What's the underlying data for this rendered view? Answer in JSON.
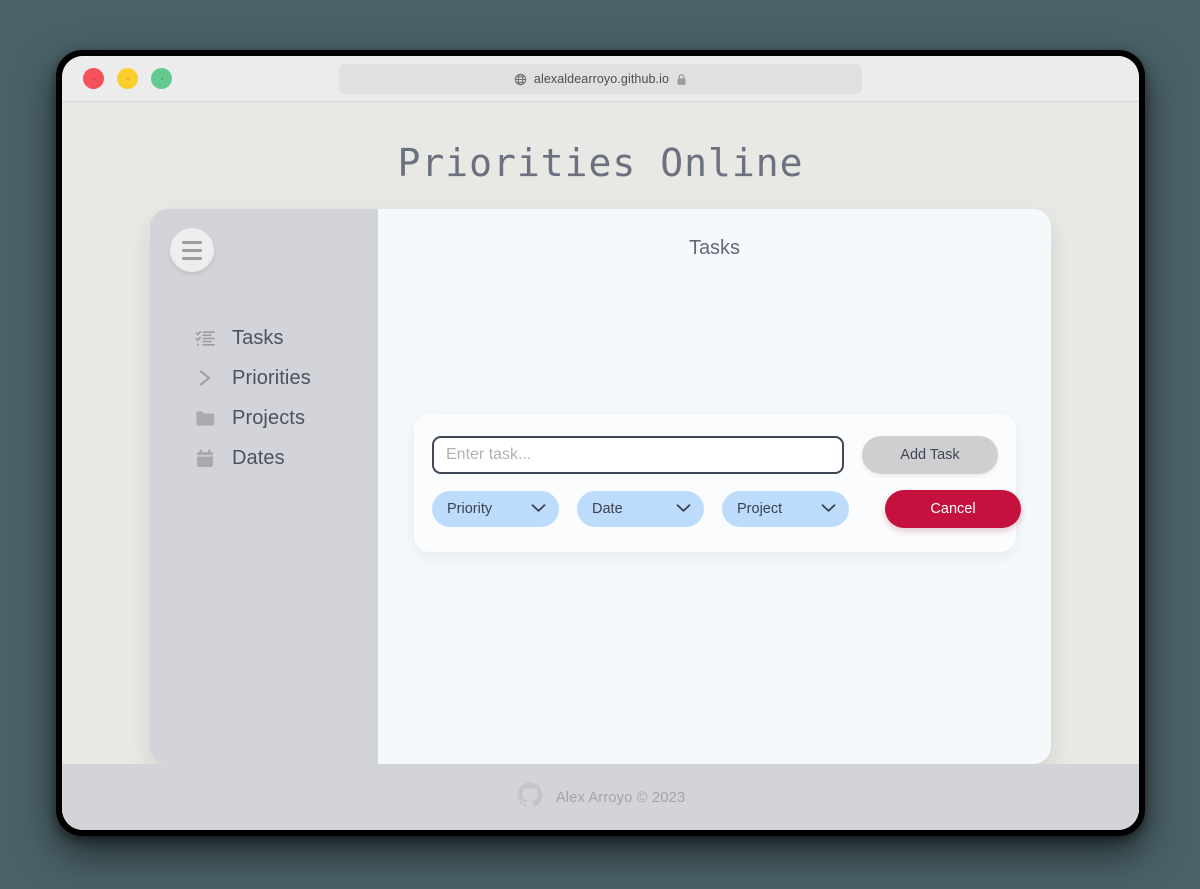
{
  "browser": {
    "traffic_lights": [
      {
        "name": "close",
        "color": "#f5515b"
      },
      {
        "name": "minimize",
        "color": "#facf2d"
      },
      {
        "name": "maximize",
        "color": "#62c98f"
      }
    ],
    "url": "alexaldearroyo.github.io",
    "globe_icon": "globe-icon",
    "lock_icon": "lock-icon"
  },
  "page": {
    "title": "Priorities Online",
    "background": "#e8e8e5"
  },
  "sidebar": {
    "menu_button_icon": "hamburger-icon",
    "items": [
      {
        "label": "Tasks",
        "icon": "checklist-icon"
      },
      {
        "label": "Priorities",
        "icon": "chevron-right-icon"
      },
      {
        "label": "Projects",
        "icon": "folder-icon"
      },
      {
        "label": "Dates",
        "icon": "calendar-icon"
      }
    ]
  },
  "main": {
    "title": "Tasks",
    "task_form": {
      "input_placeholder": "Enter task...",
      "input_value": "",
      "add_label": "Add Task",
      "cancel_label": "Cancel",
      "dropdowns": [
        {
          "label": "Priority",
          "icon": "chevron-down-icon"
        },
        {
          "label": "Date",
          "icon": "chevron-down-icon"
        },
        {
          "label": "Project",
          "icon": "chevron-down-icon"
        }
      ]
    }
  },
  "footer": {
    "icon": "github-icon",
    "text": "Alex Arroyo © 2023"
  },
  "colors": {
    "accent_red": "#c4113d",
    "dropdown_blue": "#bddcfb",
    "sidebar_gray": "#d3d4d9",
    "panel_white": "#f6f9fc"
  }
}
